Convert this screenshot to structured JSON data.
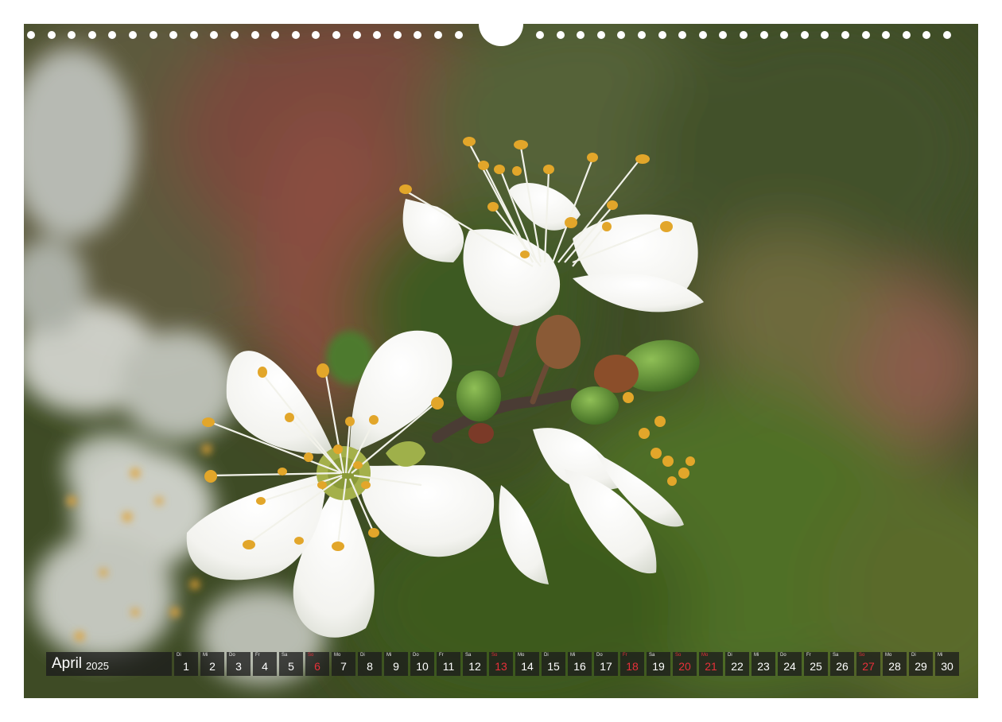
{
  "calendar": {
    "month": "April",
    "year": "2025",
    "days": [
      {
        "wd": "Di",
        "d": "1"
      },
      {
        "wd": "Mi",
        "d": "2"
      },
      {
        "wd": "Do",
        "d": "3"
      },
      {
        "wd": "Fr",
        "d": "4"
      },
      {
        "wd": "Sa",
        "d": "5"
      },
      {
        "wd": "So",
        "d": "6",
        "sun": true
      },
      {
        "wd": "Mo",
        "d": "7"
      },
      {
        "wd": "Di",
        "d": "8"
      },
      {
        "wd": "Mi",
        "d": "9"
      },
      {
        "wd": "Do",
        "d": "10"
      },
      {
        "wd": "Fr",
        "d": "11"
      },
      {
        "wd": "Sa",
        "d": "12"
      },
      {
        "wd": "So",
        "d": "13",
        "sun": true
      },
      {
        "wd": "Mo",
        "d": "14"
      },
      {
        "wd": "Di",
        "d": "15"
      },
      {
        "wd": "Mi",
        "d": "16"
      },
      {
        "wd": "Do",
        "d": "17"
      },
      {
        "wd": "Fr",
        "d": "18",
        "sun": true
      },
      {
        "wd": "Sa",
        "d": "19"
      },
      {
        "wd": "So",
        "d": "20",
        "sun": true
      },
      {
        "wd": "Mo",
        "d": "21",
        "sun": true
      },
      {
        "wd": "Di",
        "d": "22"
      },
      {
        "wd": "Mi",
        "d": "23"
      },
      {
        "wd": "Do",
        "d": "24"
      },
      {
        "wd": "Fr",
        "d": "25"
      },
      {
        "wd": "Sa",
        "d": "26"
      },
      {
        "wd": "So",
        "d": "27",
        "sun": true
      },
      {
        "wd": "Mo",
        "d": "28"
      },
      {
        "wd": "Di",
        "d": "29"
      },
      {
        "wd": "Mi",
        "d": "30"
      }
    ]
  },
  "colors": {
    "holiday": "#e8303a",
    "cell_bg": "#1c1c1c",
    "petal": "#f7f7f4",
    "anther": "#e2a62a",
    "background_green": "#3c4a24"
  },
  "icons": [
    "binding-hole-icon",
    "hanger-notch-icon"
  ]
}
